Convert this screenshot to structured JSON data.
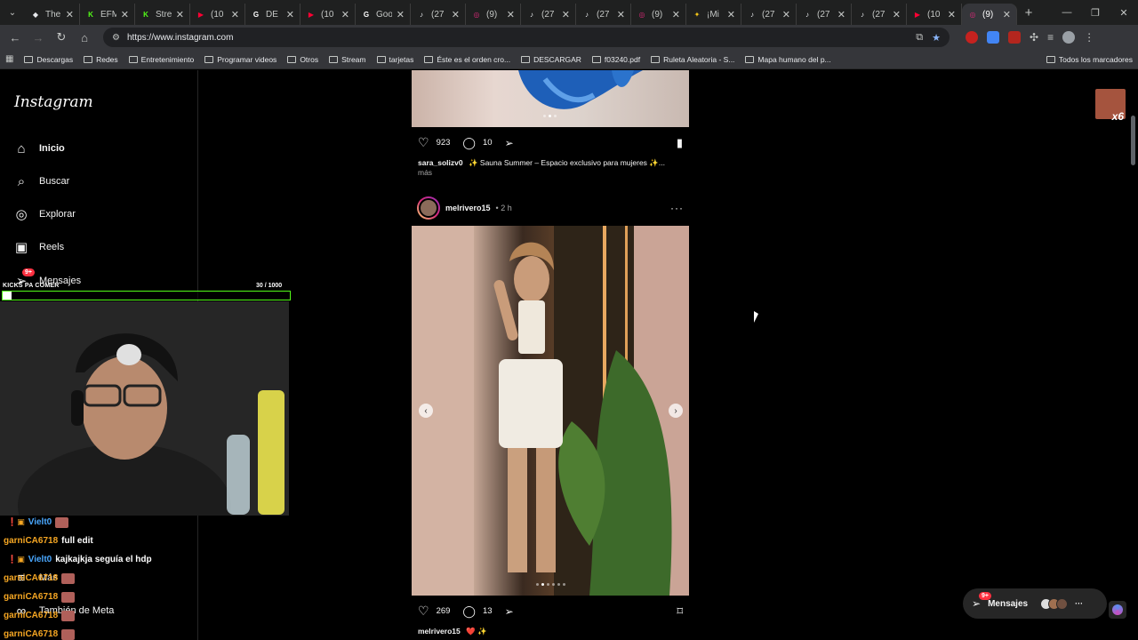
{
  "browser": {
    "tabs": [
      {
        "label": "The",
        "color": "#e8eaed",
        "glyph": "◆"
      },
      {
        "label": "EFM",
        "color": "#53fc18",
        "glyph": "K"
      },
      {
        "label": "Stre",
        "color": "#53fc18",
        "glyph": "K"
      },
      {
        "label": "(10",
        "color": "#ff0033",
        "glyph": "▶"
      },
      {
        "label": "DE",
        "color": "#ffffff",
        "glyph": "G"
      },
      {
        "label": "(10",
        "color": "#ff0033",
        "glyph": "▶"
      },
      {
        "label": "Goo",
        "color": "#ffffff",
        "glyph": "G"
      },
      {
        "label": "(27",
        "color": "#e8eaed",
        "glyph": "♪"
      },
      {
        "label": "(9)",
        "color": "#d62976",
        "glyph": "◎"
      },
      {
        "label": "(27",
        "color": "#e8eaed",
        "glyph": "♪"
      },
      {
        "label": "(27",
        "color": "#e8eaed",
        "glyph": "♪"
      },
      {
        "label": "(9)",
        "color": "#d62976",
        "glyph": "◎"
      },
      {
        "label": "¡Mi",
        "color": "#f5c518",
        "glyph": "✦"
      },
      {
        "label": "(27",
        "color": "#e8eaed",
        "glyph": "♪"
      },
      {
        "label": "(27",
        "color": "#e8eaed",
        "glyph": "♪"
      },
      {
        "label": "(27",
        "color": "#e8eaed",
        "glyph": "♪"
      },
      {
        "label": "(10",
        "color": "#ff0033",
        "glyph": "▶"
      },
      {
        "label": "(9)",
        "color": "#d62976",
        "glyph": "◎"
      }
    ],
    "active_tab_index": 17,
    "url": "https://www.instagram.com",
    "bookmarks": [
      "Descargas",
      "Redes",
      "Entretenimiento",
      "Programar videos",
      "Otros",
      "Stream",
      "tarjetas",
      "Éste es el orden cro...",
      "DESCARGAR",
      "f03240.pdf",
      "Ruleta Aleatoria - S...",
      "Mapa humano del p..."
    ],
    "bookmarks_right": "Todos los marcadores"
  },
  "instagram": {
    "logo": "Instagram",
    "nav": [
      {
        "label": "Inicio",
        "icon": "home-icon"
      },
      {
        "label": "Buscar",
        "icon": "search-icon"
      },
      {
        "label": "Explorar",
        "icon": "compass-icon"
      },
      {
        "label": "Reels",
        "icon": "reels-icon"
      },
      {
        "label": "Mensajes",
        "icon": "messenger-icon"
      },
      {
        "label": "Más",
        "icon": "menu-icon"
      },
      {
        "label": "También de Meta",
        "icon": "meta-icon"
      }
    ],
    "messages_badge": "9+",
    "post1": {
      "likes": "923",
      "comments": "10",
      "username": "sara_solizv0",
      "caption": "✨ Sauna Summer – Espacio exclusivo para mujeres ✨...",
      "more": "más"
    },
    "post2": {
      "username": "melrivero15",
      "time": "• 2 h",
      "likes": "269",
      "comments": "13",
      "caption": "❤️ ✨"
    },
    "messages_pill": {
      "label": "Mensajes",
      "badge": "9+"
    }
  },
  "stream_overlay": {
    "goal_title": "KICKS PA COMER",
    "goal_count": "30  / 1000",
    "goal_progress": 0.03,
    "x6_label": "x6",
    "chat": [
      {
        "user": "Vielt0",
        "msg": "",
        "color": "blue",
        "badges": true
      },
      {
        "user": "garniCA6718",
        "msg": "full edit",
        "color": "orange",
        "badges": false
      },
      {
        "user": "Vielt0",
        "msg": "kajkajkja seguía el hdp",
        "color": "blue",
        "badges": true
      },
      {
        "user": "garniCA6718",
        "msg": "",
        "color": "orange",
        "badges": false
      },
      {
        "user": "garniCA6718",
        "msg": "",
        "color": "orange",
        "badges": false
      },
      {
        "user": "garniCA6718",
        "msg": "",
        "color": "orange",
        "badges": false
      },
      {
        "user": "garniCA6718",
        "msg": "",
        "color": "orange",
        "badges": false
      }
    ]
  }
}
